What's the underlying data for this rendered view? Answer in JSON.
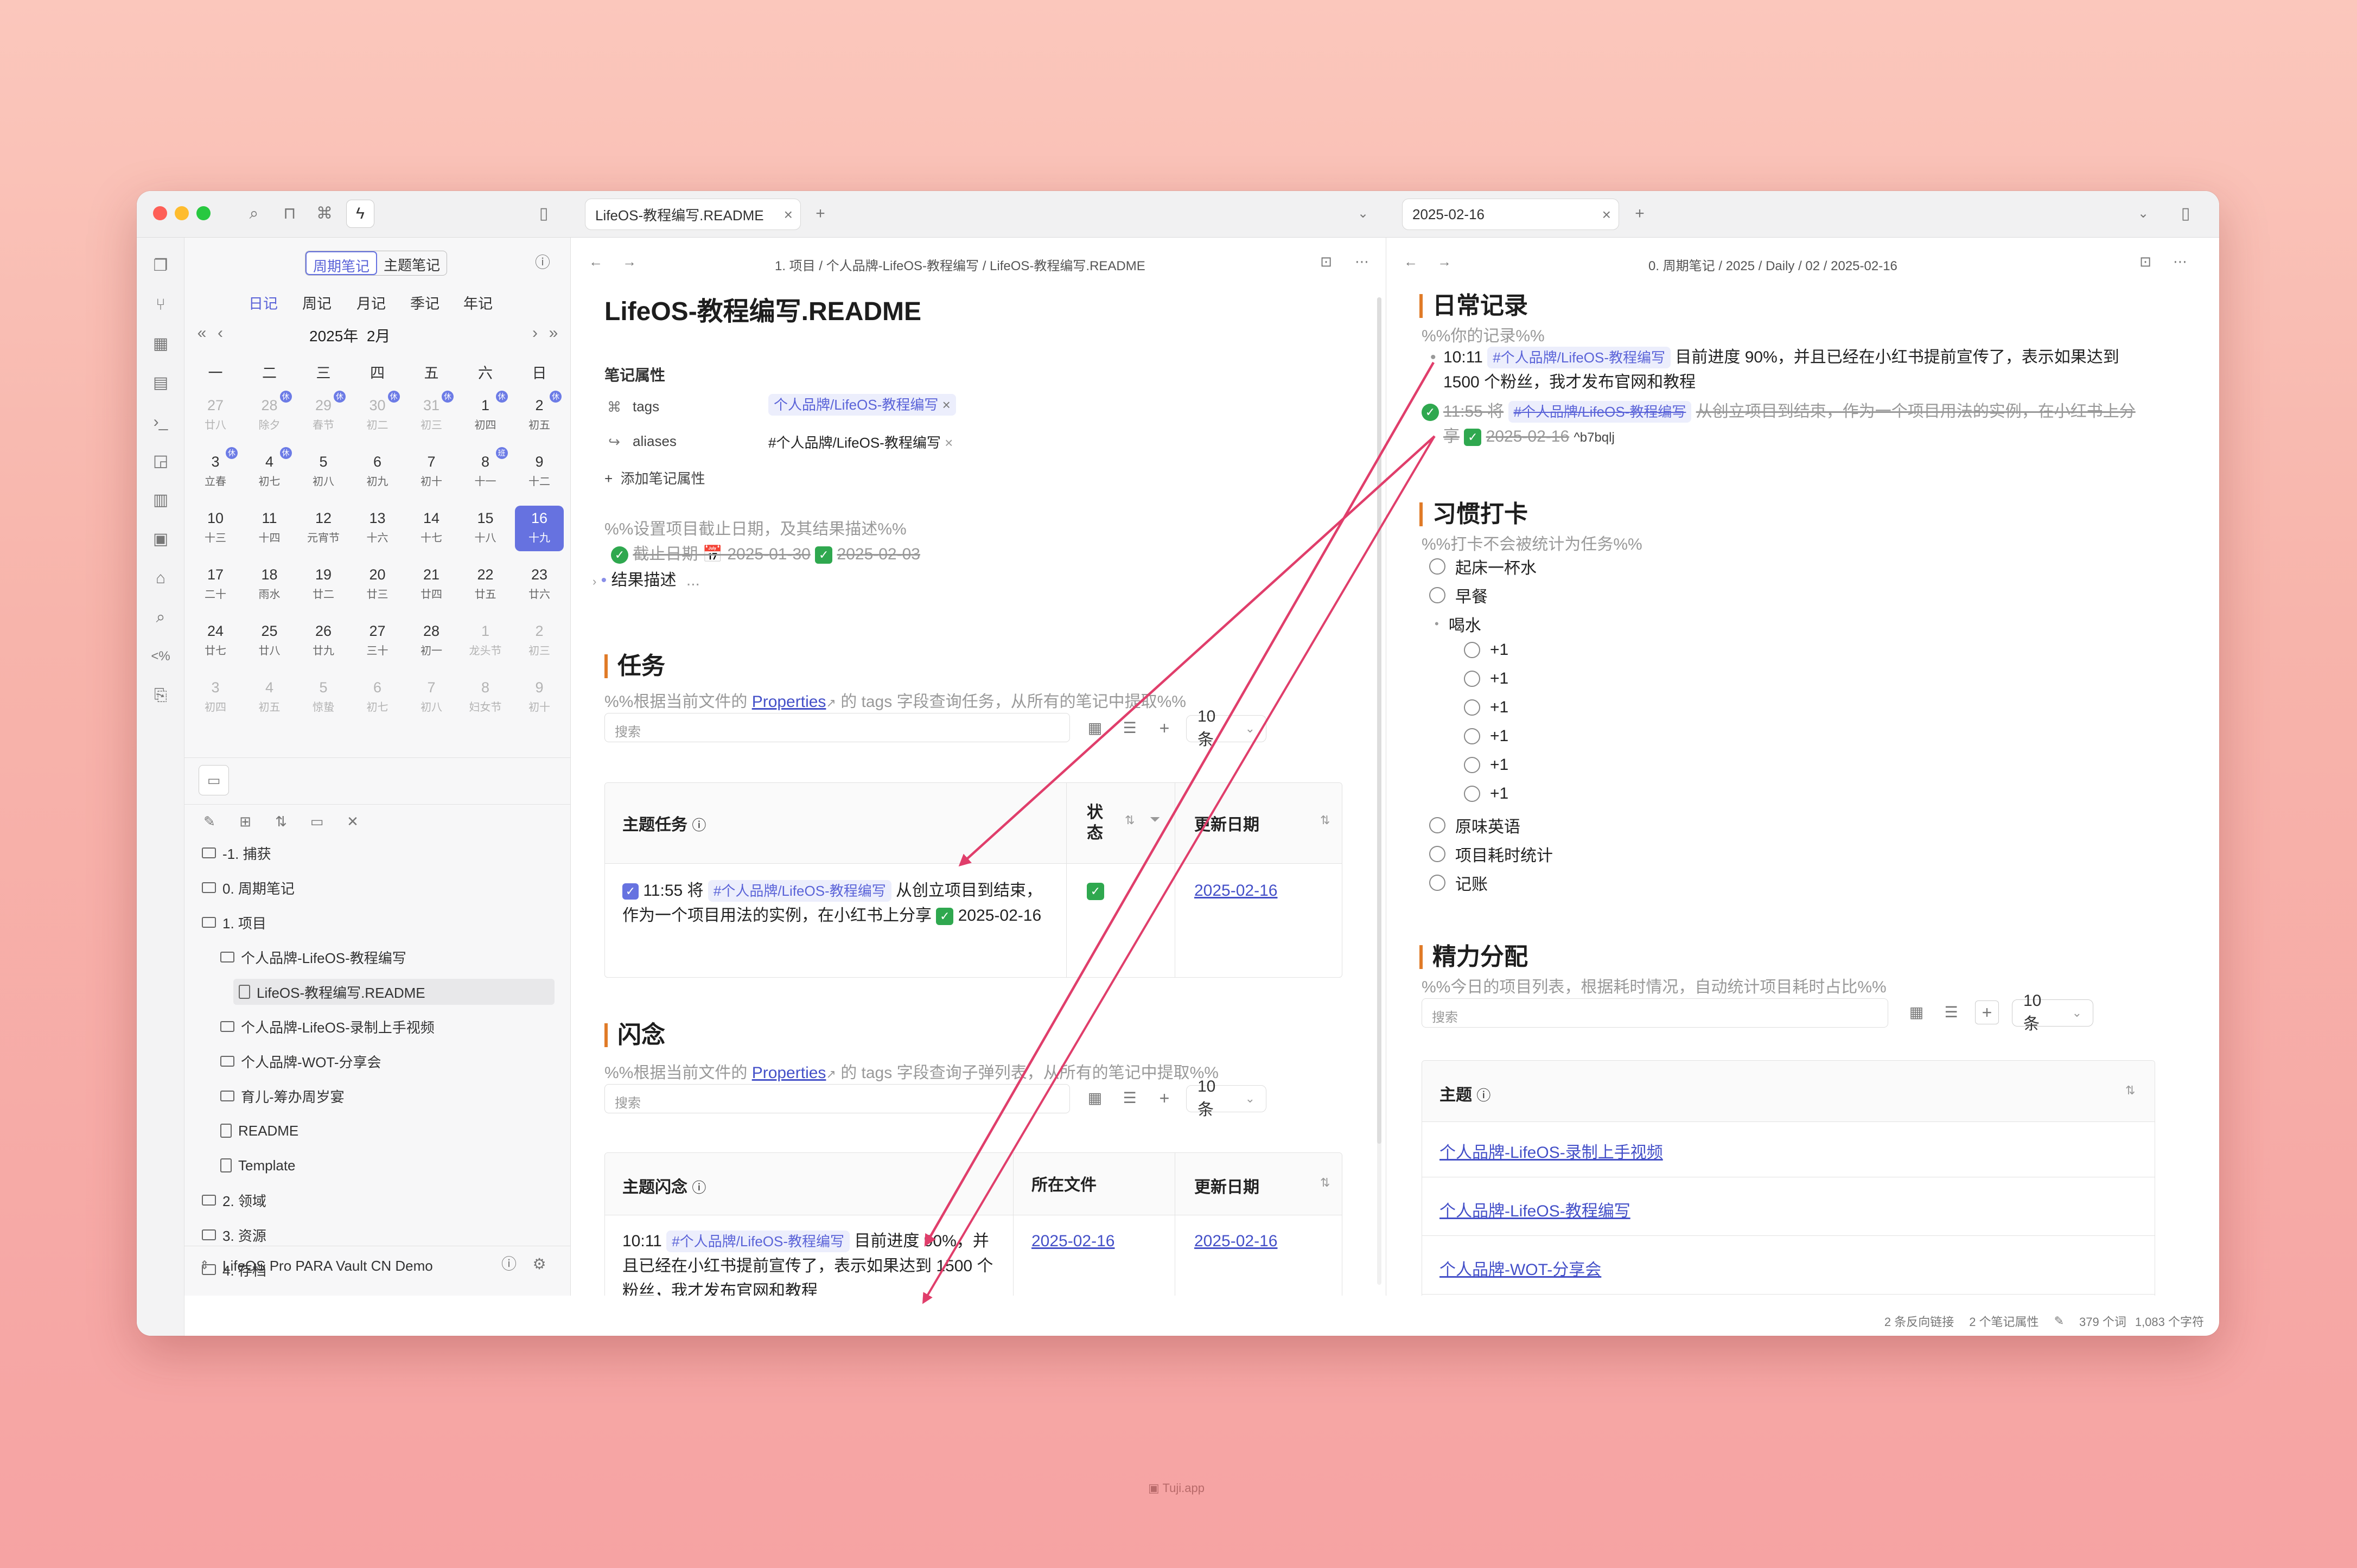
{
  "window": {
    "left_tab": "LifeOS-教程编写.README",
    "right_tab": "2025-02-16"
  },
  "sidebar": {
    "toggle": [
      "周期笔记",
      "主题笔记"
    ],
    "periods": [
      "日记",
      "周记",
      "月记",
      "季记",
      "年记"
    ],
    "month": "2025年  2月",
    "weekdays": [
      "一",
      "二",
      "三",
      "四",
      "五",
      "六",
      "日"
    ],
    "weeks": [
      [
        {
          "n": "27",
          "s": "廿八",
          "dim": true
        },
        {
          "n": "28",
          "s": "除夕",
          "dim": true,
          "b": "休"
        },
        {
          "n": "29",
          "s": "春节",
          "dim": true,
          "b": "休"
        },
        {
          "n": "30",
          "s": "初二",
          "dim": true,
          "b": "休"
        },
        {
          "n": "31",
          "s": "初三",
          "dim": true,
          "b": "休"
        },
        {
          "n": "1",
          "s": "初四",
          "b": "休"
        },
        {
          "n": "2",
          "s": "初五",
          "b": "休"
        }
      ],
      [
        {
          "n": "3",
          "s": "立春",
          "b": "休"
        },
        {
          "n": "4",
          "s": "初七",
          "b": "休"
        },
        {
          "n": "5",
          "s": "初八"
        },
        {
          "n": "6",
          "s": "初九"
        },
        {
          "n": "7",
          "s": "初十"
        },
        {
          "n": "8",
          "s": "十一",
          "b": "班"
        },
        {
          "n": "9",
          "s": "十二"
        }
      ],
      [
        {
          "n": "10",
          "s": "十三"
        },
        {
          "n": "11",
          "s": "十四"
        },
        {
          "n": "12",
          "s": "元宵节"
        },
        {
          "n": "13",
          "s": "十六"
        },
        {
          "n": "14",
          "s": "十七"
        },
        {
          "n": "15",
          "s": "十八"
        },
        {
          "n": "16",
          "s": "十九",
          "sel": true
        }
      ],
      [
        {
          "n": "17",
          "s": "二十"
        },
        {
          "n": "18",
          "s": "雨水"
        },
        {
          "n": "19",
          "s": "廿二"
        },
        {
          "n": "20",
          "s": "廿三"
        },
        {
          "n": "21",
          "s": "廿四"
        },
        {
          "n": "22",
          "s": "廿五"
        },
        {
          "n": "23",
          "s": "廿六"
        }
      ],
      [
        {
          "n": "24",
          "s": "廿七"
        },
        {
          "n": "25",
          "s": "廿八"
        },
        {
          "n": "26",
          "s": "廿九"
        },
        {
          "n": "27",
          "s": "三十"
        },
        {
          "n": "28",
          "s": "初一"
        },
        {
          "n": "1",
          "s": "龙头节",
          "dim": true
        },
        {
          "n": "2",
          "s": "初三",
          "dim": true
        }
      ],
      [
        {
          "n": "3",
          "s": "初四",
          "dim": true
        },
        {
          "n": "4",
          "s": "初五",
          "dim": true
        },
        {
          "n": "5",
          "s": "惊蛰",
          "dim": true
        },
        {
          "n": "6",
          "s": "初七",
          "dim": true
        },
        {
          "n": "7",
          "s": "初八",
          "dim": true
        },
        {
          "n": "8",
          "s": "妇女节",
          "dim": true
        },
        {
          "n": "9",
          "s": "初十",
          "dim": true
        }
      ]
    ],
    "tree": [
      {
        "label": "-1. 捕获",
        "type": "folder",
        "level": 0
      },
      {
        "label": "0. 周期笔记",
        "type": "folder",
        "level": 0
      },
      {
        "label": "1. 项目",
        "type": "folder",
        "level": 0
      },
      {
        "label": "个人品牌-LifeOS-教程编写",
        "type": "folder",
        "level": 1
      },
      {
        "label": "LifeOS-教程编写.README",
        "type": "file",
        "level": 2,
        "active": true
      },
      {
        "label": "个人品牌-LifeOS-录制上手视频",
        "type": "folder",
        "level": 1
      },
      {
        "label": "个人品牌-WOT-分享会",
        "type": "folder",
        "level": 1
      },
      {
        "label": "育儿-筹办周岁宴",
        "type": "folder",
        "level": 1
      },
      {
        "label": "README",
        "type": "file",
        "level": 1
      },
      {
        "label": "Template",
        "type": "file",
        "level": 1
      },
      {
        "label": "2. 领域",
        "type": "folder",
        "level": 0
      },
      {
        "label": "3. 资源",
        "type": "folder",
        "level": 0
      },
      {
        "label": "4. 存档",
        "type": "folder",
        "level": 0
      }
    ],
    "vault": "LifeOS Pro PARA Vault CN Demo"
  },
  "left": {
    "breadcrumb": "1. 项目  /  个人品牌-LifeOS-教程编写  /  LifeOS-教程编写.README",
    "title": "LifeOS-教程编写.README",
    "props_title": "笔记属性",
    "props": [
      {
        "key": "tags",
        "value": "个人品牌/LifeOS-教程编写"
      },
      {
        "key": "aliases",
        "value": "#个人品牌/LifeOS-教程编写"
      }
    ],
    "add_prop": "添加笔记属性",
    "deadline_comment": "%%设置项目截止日期，及其结果描述%%",
    "deadline_text": "截止日期 📅 2025-01-30",
    "deadline_done": "2025-02-03",
    "result": "结果描述",
    "result_more": "...",
    "task_h": "任务",
    "task_c_pre": "%%根据当前文件的 ",
    "task_c_link": "Properties",
    "task_c_post": " 的 tags 字段查询任务，从所有的笔记中提取%%",
    "search": "搜索",
    "count": "10 条",
    "task_cols": [
      "主题任务",
      "状\n态",
      "更新日期"
    ],
    "task_row": {
      "time": "11:55 将",
      "tag": "#个人品牌/LifeOS-教程编写",
      "rest": "从创立项目到结束，作为一个项目用法的实例，在小红书上分享",
      "date_done": "2025-02-16",
      "date": "2025-02-16"
    },
    "idea_h": "闪念",
    "idea_c_pre": "%%根据当前文件的 ",
    "idea_c_link": "Properties",
    "idea_c_post": " 的 tags 字段查询子弹列表，从所有的笔记中提取%%",
    "idea_cols": [
      "主题闪念",
      "所在文件",
      "更新日期"
    ],
    "idea_row": {
      "time": "10:11",
      "tag": "#个人品牌/LifeOS-教程编写",
      "rest": "目前进度 90%，并且已经在小红书提前宣传了，表示如果达到 1500 个粉丝，我才发布官网和教程",
      "file": "2025-02-16",
      "date": "2025-02-16"
    }
  },
  "right": {
    "breadcrumb": "0. 周期笔记  /  2025  /  Daily  /  02  /  2025-02-16",
    "daily_h": "日常记录",
    "daily_c": "%%你的记录%%",
    "entry1": {
      "time": "10:11",
      "tag": "#个人品牌/LifeOS-教程编写",
      "rest": "目前进度 90%，并且已经在小红书提前宣传了，表示如果达到 1500 个粉丝，我才发布官网和教程"
    },
    "entry2": {
      "time": "11:55 将",
      "tag": "#个人品牌/LifeOS-教程编写",
      "rest": "从创立项目到结束，作为一个项目用法的实例，在小红书上分享",
      "date": "2025-02-16",
      "ref": "^b7bqlj"
    },
    "habit_h": "习惯打卡",
    "habit_c": "%%打卡不会被统计为任务%%",
    "habits": [
      "起床一杯水",
      "早餐"
    ],
    "water": "喝水",
    "water_items": [
      "+1",
      "+1",
      "+1",
      "+1",
      "+1",
      "+1"
    ],
    "habits2": [
      "原味英语",
      "项目耗时统计",
      "记账"
    ],
    "energy_h": "精力分配",
    "energy_c": "%%今日的项目列表，根据耗时情况，自动统计项目耗时占比%%",
    "search": "搜索",
    "count": "10 条",
    "energy_col": "主题",
    "energy_rows": [
      "个人品牌-LifeOS-录制上手视频",
      "个人品牌-LifeOS-教程编写",
      "个人品牌-WOT-分享会"
    ]
  },
  "status": {
    "backlinks": "2 条反向链接",
    "props": "2 个笔记属性",
    "words": "379 个词",
    "chars": "1,083 个字符"
  },
  "watermark": "Tuji.app",
  "colors": {
    "accent": "#6672e0",
    "heading_bar": "#e07b28",
    "arrow": "#e03e6b",
    "done": "#2fa84f"
  }
}
